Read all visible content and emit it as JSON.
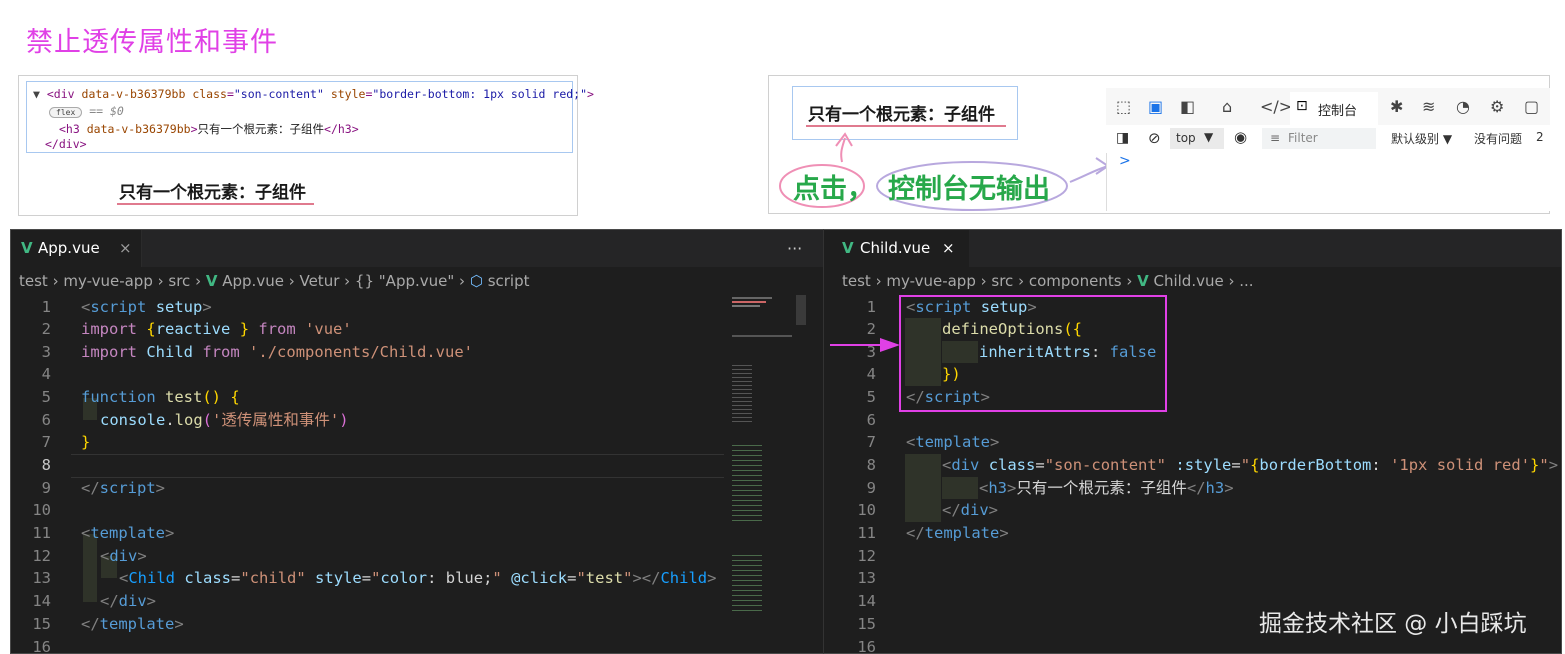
{
  "heading": "禁止透传属性和事件",
  "elements_panel": {
    "line1_tag_open": "<div",
    "line1_attr1": "data-v-b36379bb",
    "line1_attr2_name": "class",
    "line1_attr2_val": "\"son-content\"",
    "line1_attr3_name": "style",
    "line1_attr3_val": "\"border-bottom: 1px solid red;\"",
    "line1_close": ">",
    "flex_badge": "flex",
    "eq_dollar": "== $0",
    "line2_tag": "<h3",
    "line2_attr": "data-v-b36379bb",
    "line2_text": "只有一个根元素：子组件",
    "line2_close": "</h3>",
    "line3": "</div>",
    "rendered_text": "只有一个根元素：子组件"
  },
  "console_panel": {
    "rendered_text": "只有一个根元素：子组件",
    "annotation_click": "点击，",
    "annotation_no_output": "控制台无输出",
    "toolbar_tab": "控制台",
    "context": "top",
    "filter_placeholder": "Filter",
    "level": "默认级别",
    "issues": "没有问题",
    "issues_count": "2",
    "prompt": ">"
  },
  "left_editor": {
    "tab_label": "App.vue",
    "more": "···",
    "close": "×",
    "breadcrumb": [
      "test",
      "my-vue-app",
      "src",
      "App.vue",
      "Vetur",
      "{} \"App.vue\"",
      "script"
    ],
    "lines": [
      "1",
      "2",
      "3",
      "4",
      "5",
      "6",
      "7",
      "8",
      "9",
      "10",
      "11",
      "12",
      "13",
      "14",
      "15",
      "16"
    ]
  },
  "right_editor": {
    "tab_label": "Child.vue",
    "close": "×",
    "breadcrumb": [
      "test",
      "my-vue-app",
      "src",
      "components",
      "Child.vue",
      "..."
    ],
    "lines": [
      "1",
      "2",
      "3",
      "4",
      "5",
      "6",
      "7",
      "8",
      "9",
      "10",
      "11",
      "12",
      "13",
      "14",
      "15",
      "16"
    ]
  },
  "watermark": "掘金技术社区 @ 小白踩坑",
  "colors": {
    "accent": "#e040e6",
    "annotation": "#27a84a",
    "vue": "#41b883"
  }
}
